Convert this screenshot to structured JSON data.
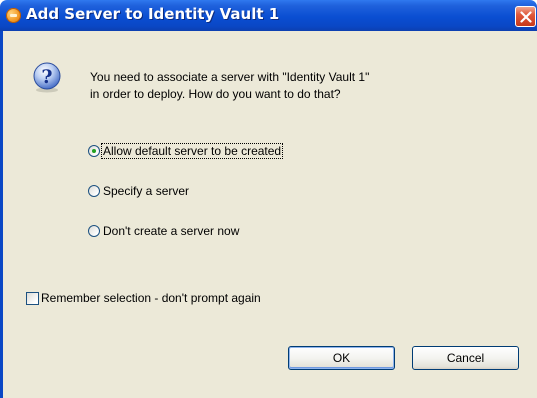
{
  "window": {
    "title": "Add Server to Identity Vault 1",
    "title_icon": "identity-manager-icon",
    "close_icon": "close-icon"
  },
  "message": {
    "icon": "question-icon",
    "line1": "You need to associate a server with \"Identity Vault 1\"",
    "line2": "in order to deploy.  How do you want to do that?"
  },
  "options": [
    {
      "label": "Allow default server to be created",
      "checked": true
    },
    {
      "label": "Specify a server",
      "checked": false
    },
    {
      "label": "Don't create a server now",
      "checked": false
    }
  ],
  "remember": {
    "label": "Remember selection - don't prompt again",
    "checked": false
  },
  "buttons": {
    "ok": "OK",
    "cancel": "Cancel"
  },
  "colors": {
    "titlebar": "#0a4ed2",
    "dialog_face": "#ece9d8",
    "radio_dot": "#21a121",
    "close_button": "#e0583a"
  }
}
